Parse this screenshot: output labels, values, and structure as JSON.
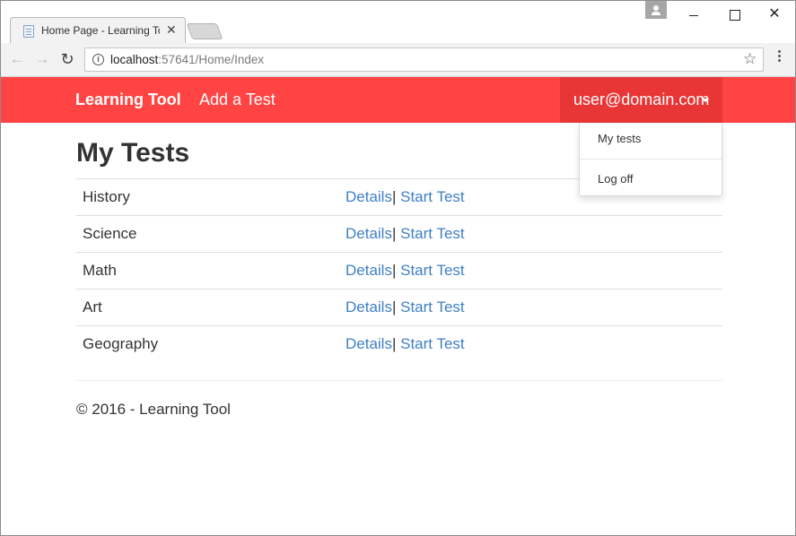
{
  "browser": {
    "tab_title": "Home Page - Learning To",
    "url_host": "localhost",
    "url_rest": ":57641/Home/Index",
    "close_glyph": "✕"
  },
  "navbar": {
    "brand": "Learning Tool",
    "add_test": "Add a Test",
    "user": "user@domain.com",
    "accent_color": "#ff4443"
  },
  "dropdown": {
    "items": [
      "My tests",
      "Log off"
    ]
  },
  "main": {
    "heading": "My Tests",
    "tests": [
      {
        "name": "History",
        "details": "Details",
        "separator": "|",
        "start": "Start Test"
      },
      {
        "name": "Science",
        "details": "Details",
        "separator": "|",
        "start": "Start Test"
      },
      {
        "name": "Math",
        "details": "Details",
        "separator": "|",
        "start": "Start Test"
      },
      {
        "name": "Art",
        "details": "Details",
        "separator": "|",
        "start": "Start Test"
      },
      {
        "name": "Geography",
        "details": "Details",
        "separator": "|",
        "start": "Start Test"
      }
    ]
  },
  "footer": {
    "text": "© 2016 - Learning Tool"
  },
  "icons": {
    "back": "back-arrow-icon",
    "forward": "forward-arrow-icon",
    "reload": "reload-icon",
    "info": "info-icon",
    "star": "star-icon",
    "menu": "kebab-menu-icon"
  }
}
